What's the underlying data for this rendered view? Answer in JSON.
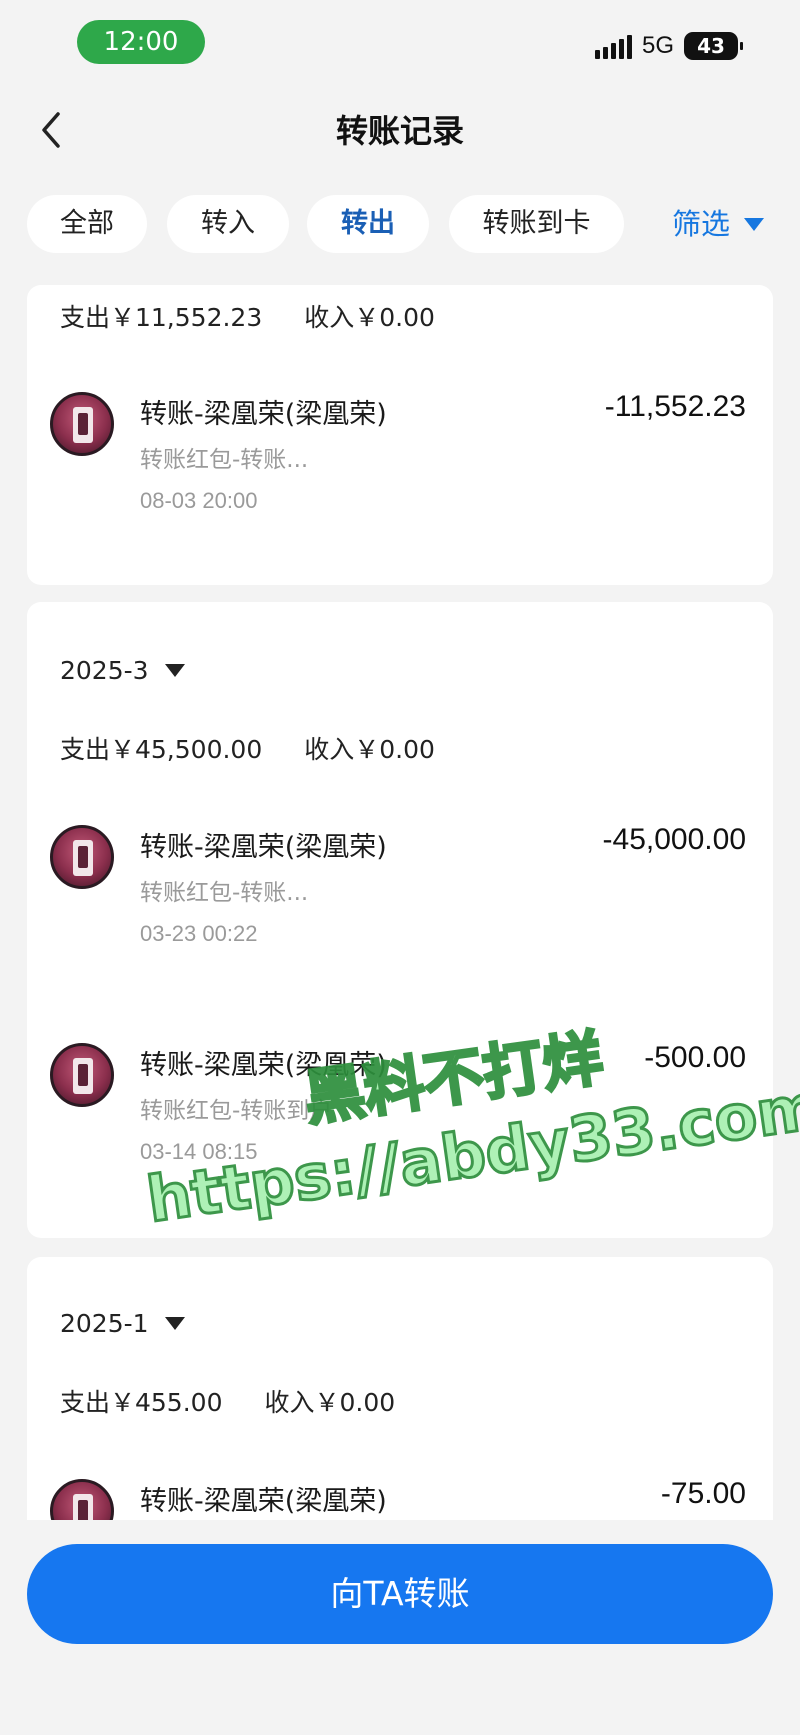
{
  "status_bar": {
    "time": "12:00",
    "network": "5G",
    "battery": "43",
    "signal_icon": "signal-bars-icon"
  },
  "nav": {
    "back_icon": "chevron-left-icon",
    "title": "转账记录"
  },
  "tabs": [
    {
      "label": "全部",
      "active": false
    },
    {
      "label": "转入",
      "active": false
    },
    {
      "label": "转出",
      "active": true
    },
    {
      "label": "转账到卡",
      "active": false
    }
  ],
  "filter": {
    "label": "筛选",
    "icon": "triangle-down-icon"
  },
  "groups": [
    {
      "summary": {
        "expense": "支出￥11,552.23",
        "income": "收入￥0.00"
      },
      "transactions": [
        {
          "title": "转账-梁凰荣(梁凰荣)",
          "subtitle": "转账红包-转账...",
          "time": "08-03 20:00",
          "amount": "-11,552.23"
        }
      ]
    },
    {
      "month": "2025-3",
      "summary": {
        "expense": "支出￥45,500.00",
        "income": "收入￥0.00"
      },
      "transactions": [
        {
          "title": "转账-梁凰荣(梁凰荣)",
          "subtitle": "转账红包-转账...",
          "time": "03-23 00:22",
          "amount": "-45,000.00"
        },
        {
          "title": "转账-梁凰荣(梁凰荣)",
          "subtitle": "转账红包-转账到户",
          "time": "03-14 08:15",
          "amount": "-500.00"
        }
      ]
    },
    {
      "month": "2025-1",
      "summary": {
        "expense": "支出￥455.00",
        "income": "收入￥0.00"
      },
      "transactions": [
        {
          "title": "转账-梁凰荣(梁凰荣)",
          "subtitle": "",
          "time": "",
          "amount": "-75.00"
        }
      ]
    }
  ],
  "watermark": {
    "line1": "黑料不打烊",
    "line2": "https://abdy33.com"
  },
  "bottom": {
    "transfer_label": "向TA转账"
  },
  "colors": {
    "accent": "#1677f0",
    "active_tab": "#1a5fb5",
    "time_pill": "#2ea84a",
    "watermark_fill": "#a8f0b0",
    "watermark_stroke": "#2d8f3c"
  }
}
